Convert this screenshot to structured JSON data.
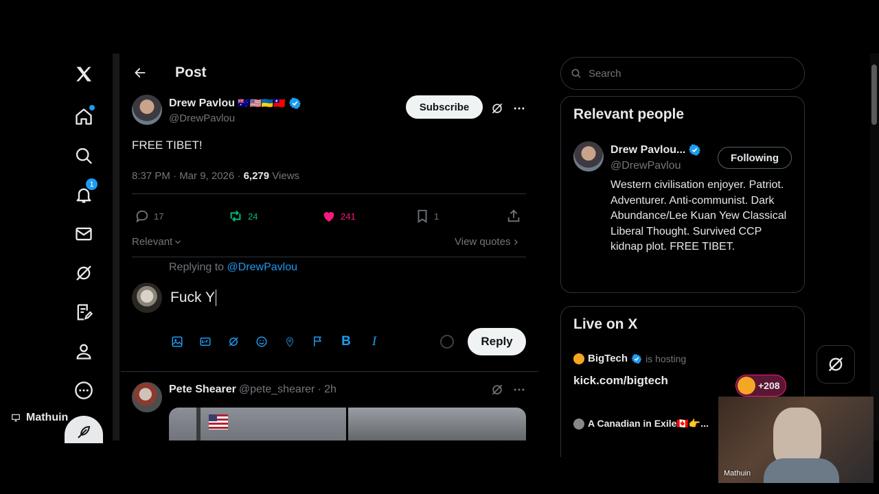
{
  "nav": {
    "notifications_count": "1",
    "profile_name": "Mathuin"
  },
  "header": {
    "title": "Post"
  },
  "post": {
    "author_name": "Drew Pavlou",
    "author_flags": "🇦🇺🇺🇸🇺🇦🇹🇼",
    "author_handle": "@DrewPavlou",
    "subscribe_label": "Subscribe",
    "text": "FREE TIBET!",
    "timestamp": "8:37 PM · Mar 9, 2026 · ",
    "views_count": "6,279",
    "views_label": " Views",
    "replies": "17",
    "reposts": "24",
    "likes": "241",
    "bookmarks": "1",
    "sort_label": "Relevant",
    "view_quotes_label": "View quotes"
  },
  "composer": {
    "replying_prefix": "Replying to ",
    "replying_handle": "@DrewPavlou",
    "draft_text": "Fuck Y",
    "reply_label": "Reply"
  },
  "reply_item": {
    "author_name": "Pete Shearer",
    "author_handle": "@pete_shearer",
    "time": " · 2h"
  },
  "search": {
    "placeholder": "Search"
  },
  "relevant_people": {
    "title": "Relevant people",
    "name": "Drew Pavlou...",
    "handle": "@DrewPavlou",
    "following_label": "Following",
    "bio": "Western civilisation enjoyer. Patriot. Adventurer. Anti-communist. Dark Abundance/Lee Kuan Yew Classical Liberal Thought. Survived CCP kidnap plot. FREE TIBET."
  },
  "live": {
    "title": "Live on X",
    "host_name": "BigTech",
    "hosting_label": "is hosting",
    "space_title": "kick.com/bigtech",
    "listeners": "+208",
    "next_host": "A Canadian in Exile🇨🇦👉..."
  },
  "webcam": {
    "name": "Mathuin"
  },
  "colors": {
    "accent": "#1d9bf0",
    "like": "#f91880",
    "repost": "#00ba7c",
    "border": "#2f3336"
  }
}
